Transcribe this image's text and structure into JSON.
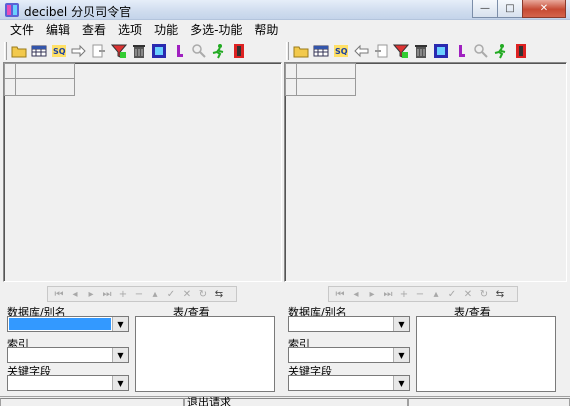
{
  "window": {
    "title": "decibel 分贝司令官",
    "minimize": "—",
    "maximize": "□",
    "close": "✕"
  },
  "menu": [
    "文件",
    "编辑",
    "查看",
    "选项",
    "功能",
    "多选-功能",
    "帮助"
  ],
  "toolbar_icons": [
    "open-folder-icon",
    "table-icon",
    "sql-icon",
    "arrow-right-icon",
    "export-icon",
    "filter-icon",
    "trash-icon",
    "db-icon",
    "lock-icon",
    "search-icon",
    "run-icon",
    "exit-icon"
  ],
  "left_panel": {
    "db_label": "数据库/别名",
    "index_label": "索引",
    "key_label": "关键字段",
    "list_header": "表/查看"
  },
  "right_panel": {
    "db_label": "数据库/别名",
    "index_label": "索引",
    "key_label": "关键字段",
    "list_header": "表/查看"
  },
  "status": {
    "text": "退出请求"
  },
  "colors": {
    "selection": "#3399ff",
    "window_bg": "#f0f0f0"
  }
}
